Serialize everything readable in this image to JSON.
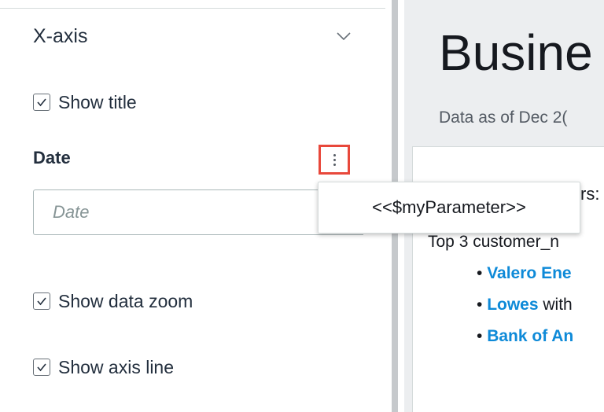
{
  "left_panel": {
    "section_title": "X-axis",
    "show_title_label": "Show title",
    "field_label": "Date",
    "date_input": {
      "value": "",
      "placeholder": "Date"
    },
    "show_data_zoom_label": "Show data zoom",
    "show_axis_line_label": "Show axis line",
    "checkboxes": {
      "show_title": true,
      "show_data_zoom": true,
      "show_axis_line": true
    }
  },
  "dropdown": {
    "items": [
      "<<$myParameter>>"
    ]
  },
  "right_panel": {
    "title": "Busine",
    "subtitle": "Data as of Dec 2(",
    "fragment": "rs:",
    "top_line": "Top 3 customer_n",
    "bullets": [
      {
        "link": "Valero Ene",
        "rest": ""
      },
      {
        "link": "Lowes",
        "rest": " with"
      },
      {
        "link": "Bank of An",
        "rest": ""
      }
    ]
  },
  "colors": {
    "highlight_border": "#e8483b",
    "link": "#0e8ad8",
    "right_background": "#eceef0"
  }
}
